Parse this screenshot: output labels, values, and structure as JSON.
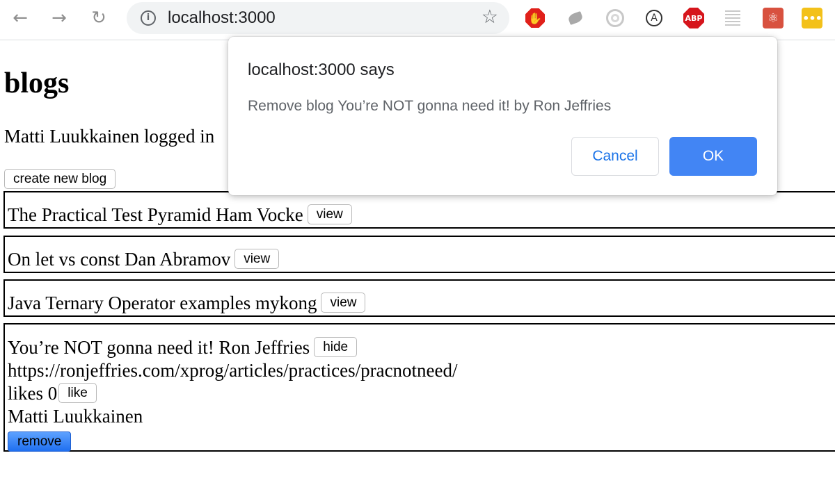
{
  "browser": {
    "url": "localhost:3000",
    "icons": {
      "back": "arrow-left",
      "forward": "arrow-right",
      "reload": "reload",
      "site_info": "info",
      "bookmark": "star"
    },
    "extensions": {
      "abp_label": "ABP"
    }
  },
  "page": {
    "title": "blogs",
    "login_status": "Matti Luukkainen logged in",
    "create_button": "create new blog",
    "blogs": [
      {
        "summary": "The Practical Test Pyramid Ham Vocke",
        "toggle": "view"
      },
      {
        "summary": "On let vs const Dan Abramov",
        "toggle": "view"
      },
      {
        "summary": "Java Ternary Operator examples mykong",
        "toggle": "view"
      },
      {
        "summary": "You’re NOT gonna need it! Ron Jeffries",
        "toggle": "hide",
        "url": "https://ronjeffries.com/xprog/articles/practices/pracnotneed/",
        "likes_text": "likes 0",
        "like_button": "like",
        "user": "Matti Luukkainen",
        "remove_button": "remove"
      }
    ]
  },
  "dialog": {
    "title": "localhost:3000 says",
    "message": "Remove blog You’re NOT gonna need it! by Ron Jeffries",
    "cancel_label": "Cancel",
    "ok_label": "OK"
  },
  "colors": {
    "ok_button": "#4285f4",
    "cancel_text": "#1a73e8",
    "remove_button": "#1f6ff0"
  }
}
